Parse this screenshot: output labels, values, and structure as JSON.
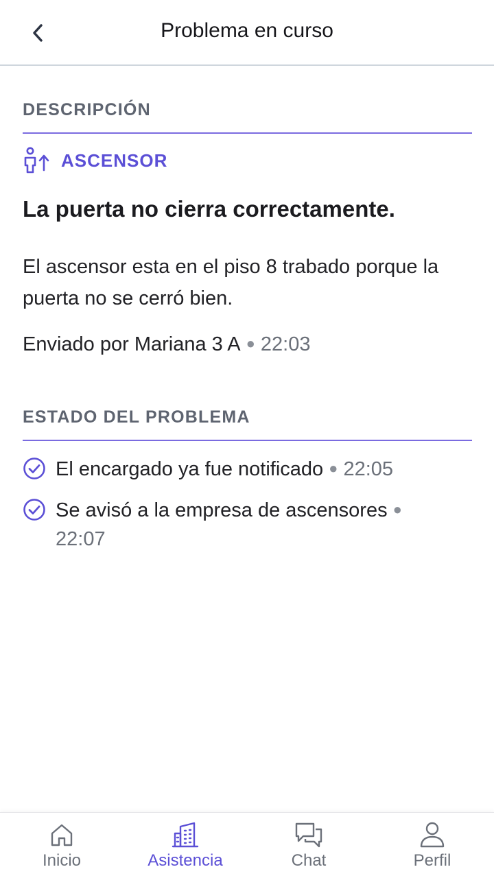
{
  "header": {
    "title": "Problema en curso",
    "back_icon": "chevron-left-icon"
  },
  "description_section": {
    "title": "DESCRIPCIÓN",
    "category_icon": "elevator-person-icon",
    "category_label": "ASCENSOR",
    "problem_title": "La puerta no cierra correctamente.",
    "problem_description": "El ascensor esta en el piso 8 trabado porque la puerta no se cerró bien.",
    "sent_by": "Enviado por Mariana 3 A",
    "sent_time": "22:03"
  },
  "status_section": {
    "title": "ESTADO DEL PROBLEMA",
    "items": [
      {
        "text": "El encargado ya fue notificado",
        "time": "22:05",
        "icon": "check-circle-icon"
      },
      {
        "text": "Se avisó a la empresa de ascensores",
        "time": "22:07",
        "icon": "check-circle-icon"
      }
    ]
  },
  "bottom_nav": {
    "items": [
      {
        "label": "Inicio",
        "icon": "home-icon",
        "active": false
      },
      {
        "label": "Asistencia",
        "icon": "building-icon",
        "active": true
      },
      {
        "label": "Chat",
        "icon": "chat-icon",
        "active": false
      },
      {
        "label": "Perfil",
        "icon": "user-icon",
        "active": false
      }
    ]
  },
  "colors": {
    "accent": "#5b4fd6",
    "divider": "#7a6be0",
    "muted_text": "#5e6470",
    "text": "#222226"
  }
}
